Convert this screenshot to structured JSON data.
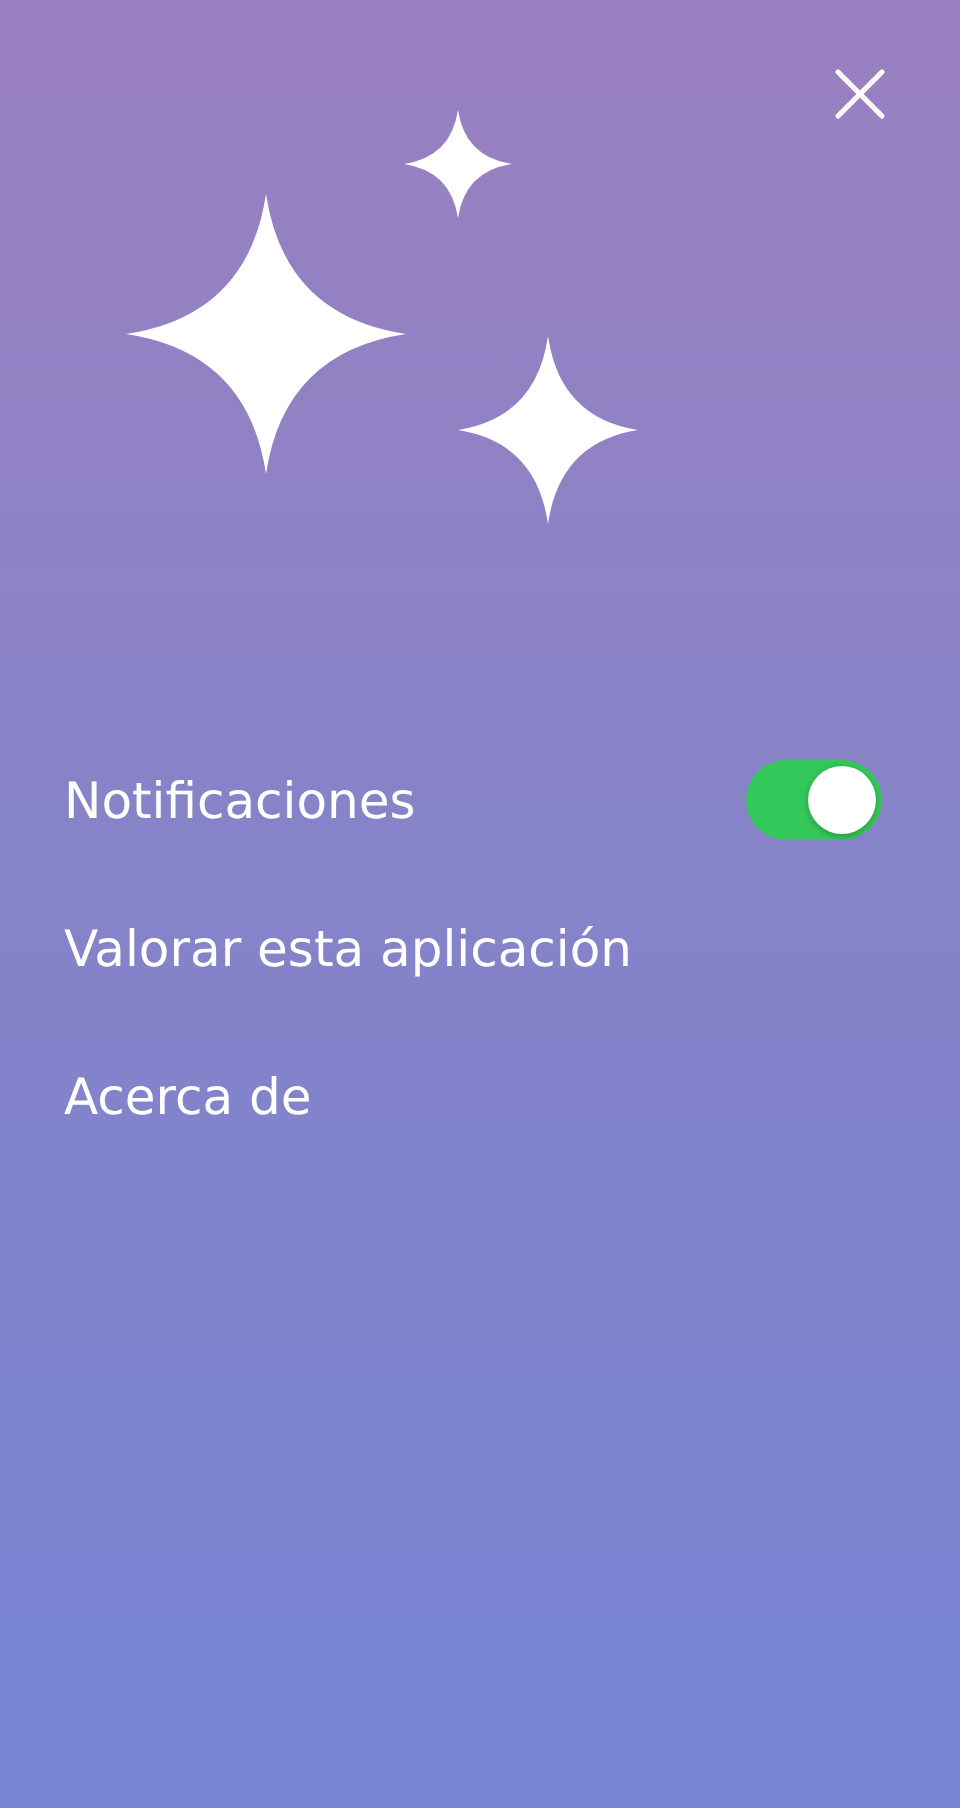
{
  "menu": [
    {
      "kind": "toggle",
      "label": "Notificaciones",
      "on": true
    },
    {
      "kind": "link",
      "label": "Valorar esta aplicación"
    },
    {
      "kind": "link",
      "label": "Acerca de"
    }
  ]
}
